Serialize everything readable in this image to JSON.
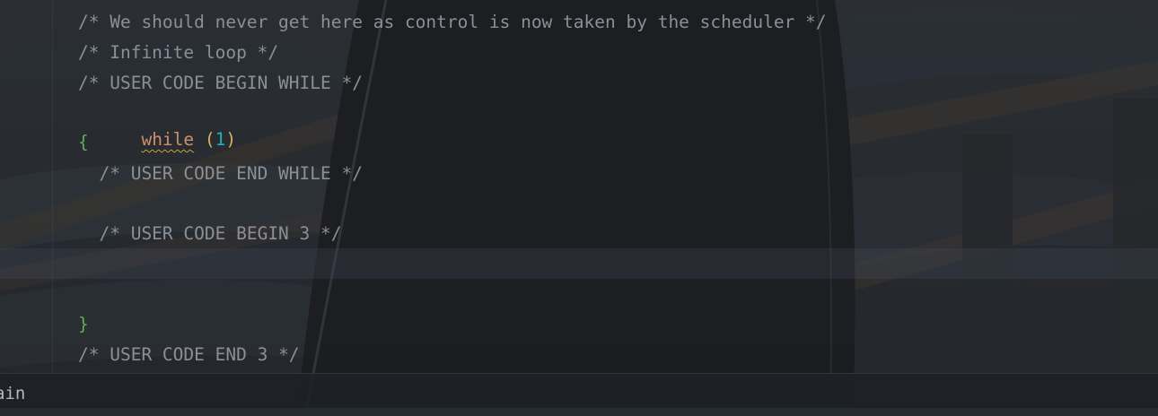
{
  "editor": {
    "lines": {
      "l1": "/* We should never get here as control is now taken by the scheduler */",
      "l2": "/* Infinite loop */",
      "l3": "/* USER CODE BEGIN WHILE */",
      "l4_keyword": "while",
      "l4_open": " (",
      "l4_number": "1",
      "l4_close": ")",
      "l5": "{",
      "l6": "  /* USER CODE END WHILE */",
      "l8": "  /* USER CODE BEGIN 3 */",
      "l11": "}",
      "l12": "/* USER CODE END 3 */"
    },
    "colors": {
      "comment": "#8b8f96",
      "keyword": "#cf8e6d",
      "number": "#2aacb8",
      "brace": "#5fad56",
      "warning_underline": "#c9a43a"
    }
  },
  "status_bar": {
    "breadcrumb": "ain"
  }
}
